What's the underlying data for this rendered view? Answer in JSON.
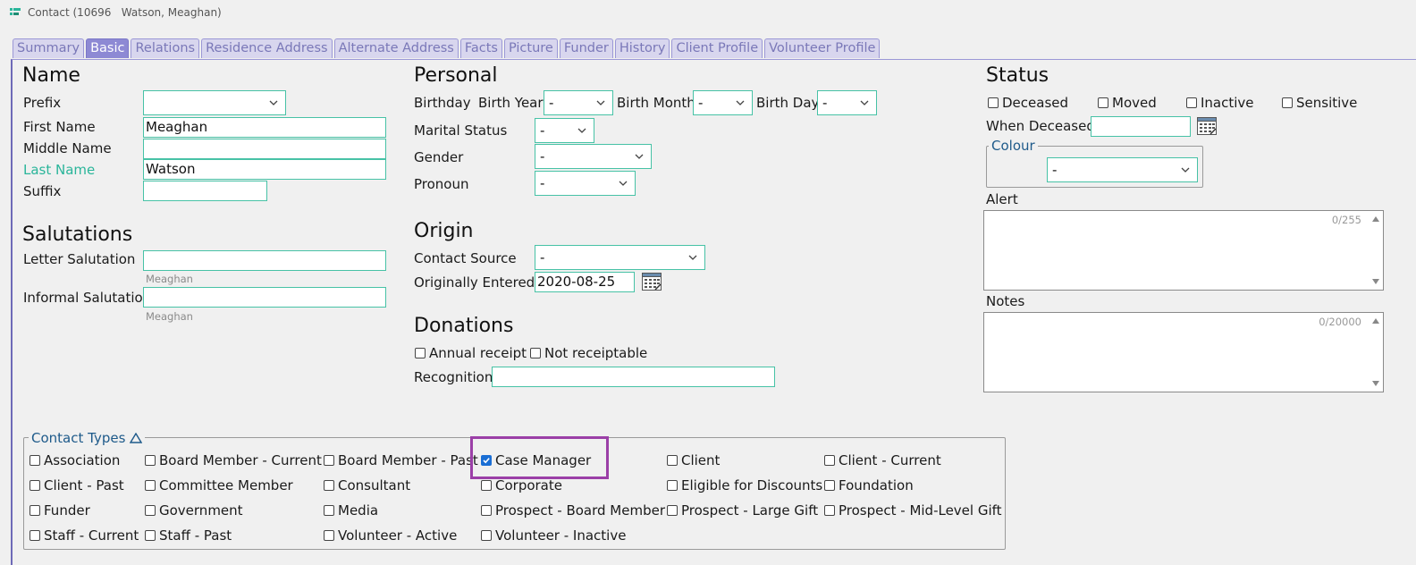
{
  "window": {
    "title": "Contact (10696   Watson, Meaghan)"
  },
  "tabs": [
    "Summary",
    "Basic",
    "Relations",
    "Residence Address",
    "Alternate Address",
    "Facts",
    "Picture",
    "Funder",
    "History",
    "Client Profile",
    "Volunteer Profile"
  ],
  "active_tab": "Basic",
  "name": {
    "heading": "Name",
    "prefix_label": "Prefix",
    "prefix_value": "",
    "first_label": "First Name",
    "first_value": "Meaghan",
    "middle_label": "Middle Name",
    "middle_value": "",
    "last_label": "Last Name",
    "last_value": "Watson",
    "suffix_label": "Suffix",
    "suffix_value": ""
  },
  "salutations": {
    "heading": "Salutations",
    "letter_label": "Letter Salutation",
    "letter_value": "",
    "letter_hint": "Meaghan",
    "informal_label": "Informal Salutation",
    "informal_value": "",
    "informal_hint": "Meaghan"
  },
  "personal": {
    "heading": "Personal",
    "birthday_label": "Birthday",
    "birth_year_label": "Birth Year",
    "birth_year_value": "-",
    "birth_month_label": "Birth Month",
    "birth_month_value": "-",
    "birth_day_label": "Birth Day",
    "birth_day_value": "-",
    "marital_label": "Marital Status",
    "marital_value": "-",
    "gender_label": "Gender",
    "gender_value": "-",
    "pronoun_label": "Pronoun",
    "pronoun_value": "-"
  },
  "origin": {
    "heading": "Origin",
    "source_label": "Contact Source",
    "source_value": "-",
    "entered_label": "Originally Entered",
    "entered_value": "2020-08-25"
  },
  "donations": {
    "heading": "Donations",
    "annual_receipt": "Annual receipt",
    "not_receiptable": "Not receiptable",
    "recognition_label": "Recognition",
    "recognition_value": ""
  },
  "status": {
    "heading": "Status",
    "deceased": "Deceased",
    "moved": "Moved",
    "inactive": "Inactive",
    "sensitive": "Sensitive",
    "when_deceased_label": "When Deceased",
    "when_deceased_value": "",
    "colour_legend": "Colour",
    "colour_value": "-",
    "alert_label": "Alert",
    "alert_counter": "0/255",
    "notes_label": "Notes",
    "notes_counter": "0/20000"
  },
  "contact_types": {
    "legend": "Contact Types",
    "items": [
      {
        "label": "Association",
        "checked": false
      },
      {
        "label": "Board Member - Current",
        "checked": false
      },
      {
        "label": "Board Member - Past",
        "checked": false
      },
      {
        "label": "Case Manager",
        "checked": true
      },
      {
        "label": "Client",
        "checked": false
      },
      {
        "label": "Client - Current",
        "checked": false
      },
      {
        "label": "Client - Past",
        "checked": false
      },
      {
        "label": "Committee Member",
        "checked": false
      },
      {
        "label": "Consultant",
        "checked": false
      },
      {
        "label": "Corporate",
        "checked": false
      },
      {
        "label": "Eligible for Discounts",
        "checked": false
      },
      {
        "label": "Foundation",
        "checked": false
      },
      {
        "label": "Funder",
        "checked": false
      },
      {
        "label": "Government",
        "checked": false
      },
      {
        "label": "Media",
        "checked": false
      },
      {
        "label": "Prospect - Board Member",
        "checked": false
      },
      {
        "label": "Prospect - Large Gift",
        "checked": false
      },
      {
        "label": "Prospect - Mid-Level Gift",
        "checked": false
      },
      {
        "label": "Staff - Current",
        "checked": false
      },
      {
        "label": "Staff - Past",
        "checked": false
      },
      {
        "label": "Volunteer - Active",
        "checked": false
      },
      {
        "label": "Volunteer - Inactive",
        "checked": false
      }
    ]
  },
  "colors": {
    "accent": "#8d89d4",
    "field_border": "#47c2a6",
    "highlight": "#9b3fa7",
    "legend_text": "#1e5a8a"
  }
}
